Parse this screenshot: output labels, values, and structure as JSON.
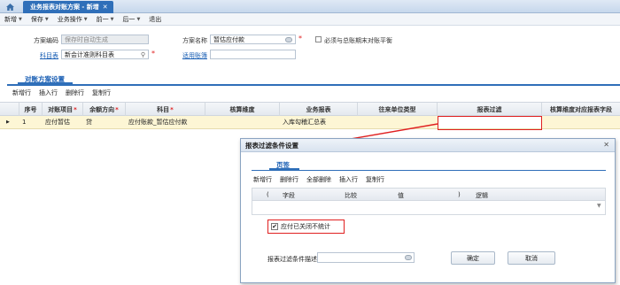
{
  "window": {
    "tab_title": "业务报表对账方案 - 新增"
  },
  "menubar": {
    "items": [
      {
        "label": "新增",
        "caret": true
      },
      {
        "label": "保存",
        "caret": true
      },
      {
        "label": "业务操作",
        "caret": true
      },
      {
        "label": "前一",
        "caret": true
      },
      {
        "label": "后一",
        "caret": true
      },
      {
        "label": "退出",
        "caret": false
      }
    ]
  },
  "form": {
    "scheme_code_label": "方案编码",
    "scheme_code_value": "保存时自动生成",
    "scheme_name_label": "方案名称",
    "scheme_name_value": "暂估应付款",
    "period_check_label": "必须与总账期末对账平衡",
    "subject_table_label": "科目表",
    "subject_table_value": "新会计准则科目表",
    "applicable_org_label": "适用账簿"
  },
  "section": {
    "title": "对账方案设置",
    "ops": [
      "新增行",
      "插入行",
      "删除行",
      "复制行"
    ]
  },
  "grid": {
    "headers": {
      "seq": "序号",
      "item": "对账项目",
      "direction": "余额方向",
      "subject": "科目",
      "dim": "核算维度",
      "report": "业务报表",
      "partner": "往来单位类型",
      "filter": "报表过滤",
      "dim_field": "核算维度对应报表字段"
    },
    "rows": [
      {
        "seq": "1",
        "item": "应付暂估",
        "direction": "贷",
        "subject": "应付账款_暂估应付款",
        "dim": "",
        "report": "入库勾稽汇总表",
        "partner": "",
        "filter": "",
        "dim_field": ""
      }
    ]
  },
  "dialog": {
    "title": "报表过滤条件设置",
    "tab": "页签",
    "ops": [
      "新增行",
      "删除行",
      "全部删除",
      "插入行",
      "复制行"
    ],
    "grid_headers": {
      "lparen": "(",
      "field": "字段",
      "compare": "比较",
      "value": "值",
      "rparen": ")",
      "logic": "逻辑"
    },
    "checkbox_label": "应付已关闭不统计",
    "checkbox_checked": true,
    "desc_label": "报表过滤条件描述",
    "ok_label": "确定",
    "cancel_label": "取消"
  }
}
